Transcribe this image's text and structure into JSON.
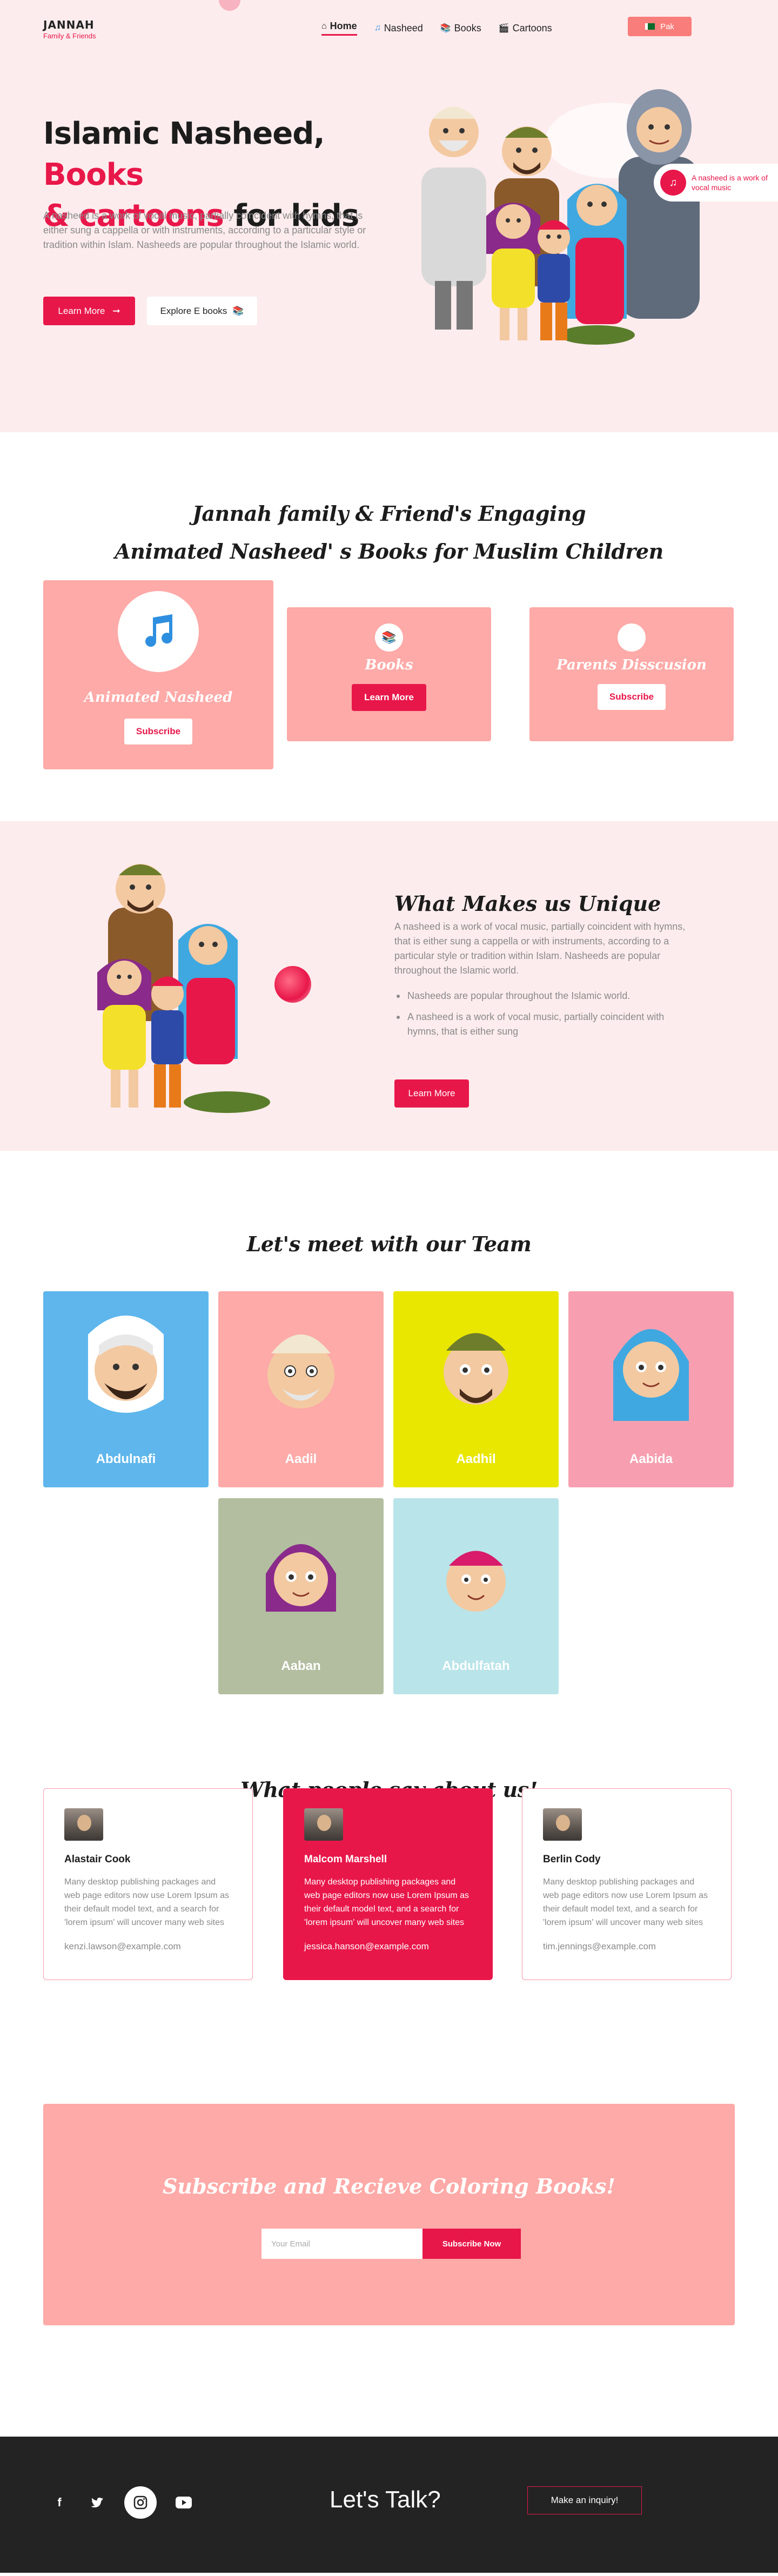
{
  "brand": {
    "name": "JANNAH",
    "tagline": "Family & Friends"
  },
  "nav": {
    "items": [
      {
        "label": "Home",
        "icon": "home-icon",
        "active": true
      },
      {
        "label": "Nasheed",
        "icon": "music-icon"
      },
      {
        "label": "Books",
        "icon": "book-icon"
      },
      {
        "label": "Cartoons",
        "icon": "film-icon"
      }
    ],
    "language": "Pak"
  },
  "hero": {
    "title_part1": "Islamic Nasheed,",
    "title_part2": "Books",
    "title_part3": "& cartoons",
    "title_part4": "for kids",
    "description": "A nasheed is a work of vocal music, partially coincident with hymns, that is either sung a cappella or with instruments, according to a particular style or tradition within Islam. Nasheeds are popular throughout the Islamic world.",
    "primary_button": "Learn More",
    "secondary_button": "Explore E books",
    "badge_text": "A nasheed is a work of vocal music"
  },
  "services": {
    "title_line1": "Jannah family & Friend's Engaging",
    "title_line2": "Animated Nasheed' s Books for Muslim Children",
    "cards": [
      {
        "name": "Animated Nasheed",
        "button": "Subscribe"
      },
      {
        "name": "Books",
        "button": "Learn More"
      },
      {
        "name": "Parents Disscusion",
        "button": "Subscribe"
      }
    ]
  },
  "unique": {
    "title": "What Makes us Unique",
    "description": "A nasheed is a work of vocal music, partially coincident with hymns, that is either sung a cappella or with instruments, according to a particular style or tradition within Islam. Nasheeds are popular throughout the Islamic world.",
    "bullets": [
      "Nasheeds are popular throughout the Islamic world.",
      "A nasheed is a work of vocal music, partially coincident with hymns, that is either sung"
    ],
    "button": "Learn More"
  },
  "team": {
    "title": "Let's meet with our Team",
    "members": [
      {
        "name": "Abdulnafi",
        "color": "#5eb6ec"
      },
      {
        "name": "Aadil",
        "color": "#fdaaa8"
      },
      {
        "name": "Aadhil",
        "color": "#e9e600"
      },
      {
        "name": "Aabida",
        "color": "#f79fb0"
      },
      {
        "name": "Aaban",
        "color": "#b3bea0"
      },
      {
        "name": "Abdulfatah",
        "color": "#b9e4e9"
      }
    ]
  },
  "testimonials": {
    "title": "What people say about us!",
    "items": [
      {
        "name": "Alastair Cook",
        "text": "Many desktop publishing packages and web page editors now use Lorem Ipsum as their default model text, and a search for 'lorem ipsum' will uncover many web sites",
        "email": "kenzi.lawson@example.com"
      },
      {
        "name": "Malcom Marshell",
        "text": "Many desktop publishing packages and web page editors now use Lorem Ipsum as their default model text, and a search for 'lorem ipsum' will uncover many web sites",
        "email": "jessica.hanson@example.com"
      },
      {
        "name": "Berlin Cody",
        "text": "Many desktop publishing packages and web page editors now use Lorem Ipsum as their default model text, and a search for 'lorem ipsum' will uncover many web sites",
        "email": "tim.jennings@example.com"
      }
    ]
  },
  "subscribe": {
    "title": "Subscribe and Recieve Coloring Books!",
    "placeholder": "Your Email",
    "button": "Subscribe Now"
  },
  "footer": {
    "talk": "Let's Talk?",
    "inquiry_button": "Make an inquiry!",
    "socials": [
      "facebook-icon",
      "twitter-icon",
      "instagram-icon",
      "youtube-icon"
    ]
  },
  "colors": {
    "accent": "#e8174a",
    "soft_pink": "#fdeced",
    "coral": "#fdaaa8",
    "footer": "#232323"
  }
}
